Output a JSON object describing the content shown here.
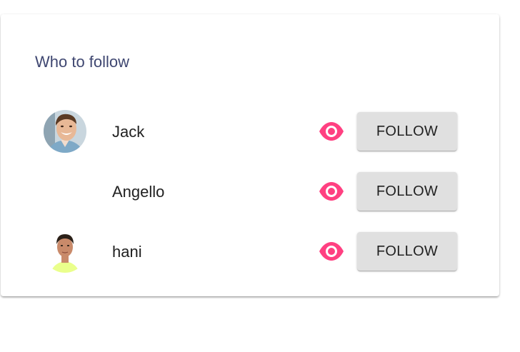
{
  "card": {
    "title": "Who to follow"
  },
  "users": [
    {
      "name": "Jack",
      "has_avatar": true,
      "follow_label": "FOLLOW",
      "view_icon": "eye-icon"
    },
    {
      "name": "Angello",
      "has_avatar": false,
      "follow_label": "FOLLOW",
      "view_icon": "eye-icon"
    },
    {
      "name": "hani",
      "has_avatar": true,
      "follow_label": "FOLLOW",
      "view_icon": "eye-icon"
    }
  ],
  "colors": {
    "accent": "#ff4081",
    "title": "#3f4771",
    "button_bg": "#e0e0e0"
  }
}
